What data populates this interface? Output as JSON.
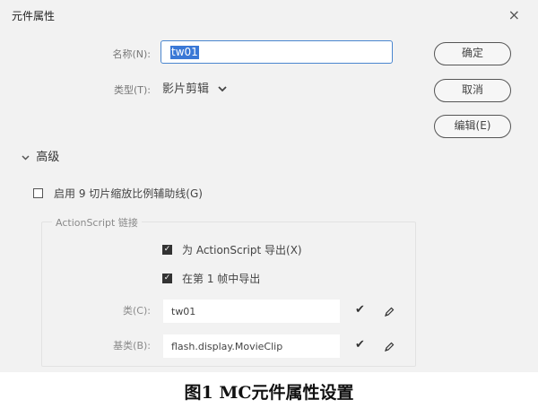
{
  "window": {
    "title": "元件属性",
    "close_glyph": "×"
  },
  "form": {
    "name_label": "名称(N):",
    "name_value": "tw01",
    "type_label": "类型(T):",
    "type_value": "影片剪辑"
  },
  "buttons": {
    "ok": "确定",
    "cancel": "取消",
    "edit": "编辑(E)"
  },
  "advanced": {
    "header": "高级",
    "nine_slice": {
      "label": "启用 9 切片缩放比例辅助线(G)",
      "checked": false
    }
  },
  "actionscript": {
    "legend": "ActionScript 链接",
    "export_for_as": {
      "label": "为 ActionScript 导出(X)",
      "checked": true
    },
    "export_frame1": {
      "label": "在第 1 帧中导出",
      "checked": true
    },
    "class_label": "类(C):",
    "class_value": "tw01",
    "base_class_label": "基类(B):",
    "base_class_value": "flash.display.MovieClip"
  },
  "icons": {
    "close": "close-icon",
    "dropdown": "chevron-down-icon",
    "section_toggle": "chevron-down-icon",
    "validate": "checkmark-icon",
    "edit": "pencil-icon"
  },
  "colors": {
    "dialog_bg": "#f2f2f2",
    "focus_border": "#4a86cf",
    "selection": "#3a78d6"
  },
  "caption": "图1   MC元件属性设置"
}
